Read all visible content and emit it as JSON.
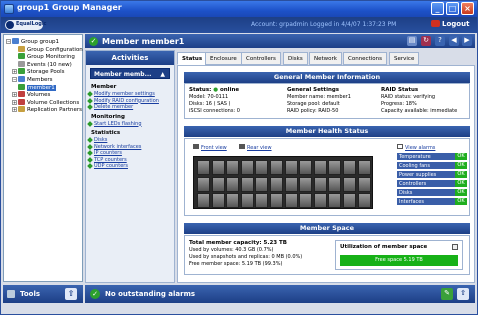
{
  "window": {
    "title": "group1 Group Manager"
  },
  "header": {
    "logo_text": "EqualLogic",
    "account": "Account: grpadmin    Logged in 4/4/07 1:37:23 PM",
    "logout": "Logout"
  },
  "tree": [
    {
      "label": "Group group1",
      "indent": 0,
      "expander": "−",
      "color": "#4a7fd0"
    },
    {
      "label": "Group Configuration",
      "indent": 2,
      "expander": "",
      "color": "#c7a040"
    },
    {
      "label": "Group Monitoring",
      "indent": 2,
      "expander": "",
      "color": "#3aa03a"
    },
    {
      "label": "Events (10 new)",
      "indent": 2,
      "expander": "",
      "color": "#9a9a9a"
    },
    {
      "label": "Storage Pools",
      "indent": 1,
      "expander": "+",
      "color": "#3aa03a"
    },
    {
      "label": "Members",
      "indent": 1,
      "expander": "−",
      "color": "#4a7fd0"
    },
    {
      "label": "member1",
      "indent": 2,
      "expander": "",
      "color": "#3aa03a",
      "selected": true
    },
    {
      "label": "Volumes",
      "indent": 1,
      "expander": "+",
      "color": "#c04040"
    },
    {
      "label": "Volume Collections",
      "indent": 1,
      "expander": "+",
      "color": "#c04040"
    },
    {
      "label": "Replication Partners",
      "indent": 1,
      "expander": "+",
      "color": "#c7a040"
    }
  ],
  "tools": {
    "label": "Tools"
  },
  "main": {
    "title": "Member member1"
  },
  "activities": {
    "title": "Activities",
    "member_box": "Member memb...",
    "sections": [
      {
        "title": "Member",
        "links": [
          "Modify member settings",
          "Modify RAID configuration",
          "Delete member"
        ]
      },
      {
        "title": "Monitoring",
        "links": [
          "Start LEDs flashing"
        ]
      },
      {
        "title": "Statistics",
        "links": [
          "Disks",
          "Network interfaces",
          "IP counters",
          "TCP counters",
          "UDP counters"
        ]
      }
    ]
  },
  "tabs": [
    "Status",
    "Enclosure",
    "Controllers",
    "Disks",
    "Network",
    "Connections",
    "Service"
  ],
  "general": {
    "title": "General Member Information",
    "status": {
      "title": "Status:",
      "value": "online",
      "lines": [
        "Model: 70-0111",
        "Disks: 16 ( SAS )",
        "iSCSI connections: 0"
      ]
    },
    "settings": {
      "title": "General Settings",
      "lines": [
        "Member name: member1",
        "Storage pool: default",
        "RAID policy: RAID-50"
      ]
    },
    "raid": {
      "title": "RAID Status",
      "lines": [
        "RAID status: verifying",
        "Progress: 18%",
        "Capacity available: immediate"
      ]
    }
  },
  "health": {
    "title": "Member Health Status",
    "front_view": "Front view",
    "rear_view": "Rear view",
    "view_alarms": "View alarms",
    "items": [
      {
        "label": "Temperature",
        "value": "OK"
      },
      {
        "label": "Cooling fans",
        "value": "OK"
      },
      {
        "label": "Power supplies",
        "value": "OK"
      },
      {
        "label": "Controllers",
        "value": "OK"
      },
      {
        "label": "Disks",
        "value": "OK"
      },
      {
        "label": "Interfaces",
        "value": "OK"
      }
    ]
  },
  "space": {
    "title": "Member Space",
    "total": "Total member capacity: 5.23 TB",
    "lines": [
      "Used by volumes: 40.3 GB (0.7%)",
      "Used by snapshots and replicas: 0 MB (0.0%)",
      "Free member space: 5.19 TB (99.3%)"
    ],
    "util_title": "Utilization of member space",
    "free_label": "Free space 5.19 TB"
  },
  "statusbar": {
    "text": "No outstanding alarms"
  }
}
